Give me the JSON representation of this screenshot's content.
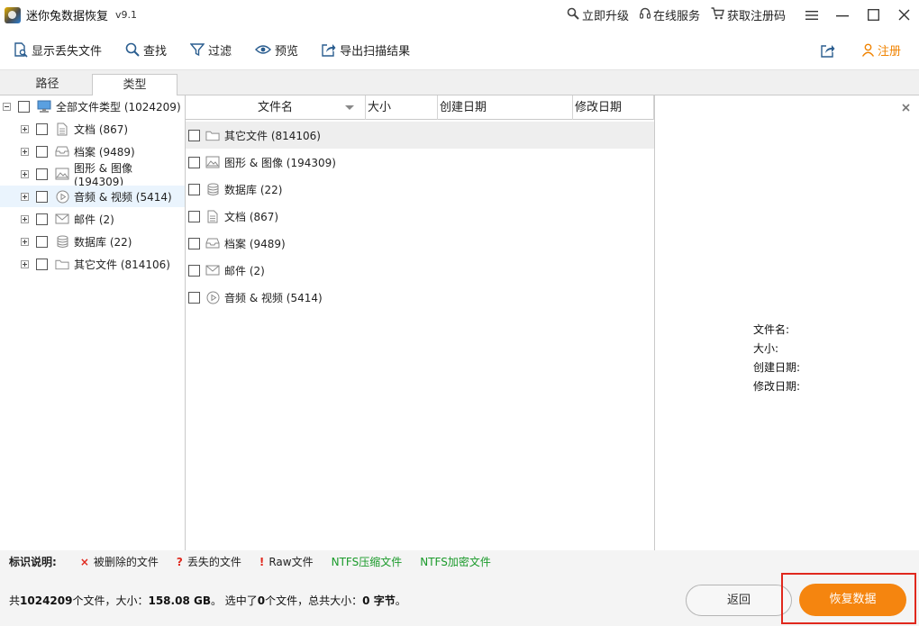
{
  "app": {
    "title": "迷你兔数据恢复",
    "version": "v9.1",
    "upgrade": "立即升级",
    "online_service": "在线服务",
    "get_code": "获取注册码"
  },
  "toolbar": {
    "show_lost": "显示丢失文件",
    "find": "查找",
    "filter": "过滤",
    "preview": "预览",
    "export": "导出扫描结果",
    "register": "注册"
  },
  "tabs": [
    "路径",
    "类型"
  ],
  "tree": {
    "root": "全部文件类型 (1024209)",
    "items": [
      {
        "label": "文档 (867)",
        "icon": "document-icon"
      },
      {
        "label": "档案 (9489)",
        "icon": "archive-icon"
      },
      {
        "label": "图形 & 图像 (194309)",
        "icon": "image-icon"
      },
      {
        "label": "音频 & 视频 (5414)",
        "icon": "media-icon"
      },
      {
        "label": "邮件 (2)",
        "icon": "mail-icon"
      },
      {
        "label": "数据库 (22)",
        "icon": "database-icon"
      },
      {
        "label": "其它文件 (814106)",
        "icon": "folder-icon"
      }
    ]
  },
  "columns": {
    "name": "文件名",
    "size": "大小",
    "created": "创建日期",
    "modified": "修改日期"
  },
  "files": [
    {
      "label": "其它文件 (814106)",
      "icon": "folder-icon"
    },
    {
      "label": "图形 & 图像 (194309)",
      "icon": "image-icon"
    },
    {
      "label": "数据库 (22)",
      "icon": "database-icon"
    },
    {
      "label": "文档 (867)",
      "icon": "document-icon"
    },
    {
      "label": "档案 (9489)",
      "icon": "archive-icon"
    },
    {
      "label": "邮件 (2)",
      "icon": "mail-icon"
    },
    {
      "label": "音频 & 视频 (5414)",
      "icon": "media-icon"
    }
  ],
  "properties": {
    "name": "文件名:",
    "size": "大小:",
    "created": "创建日期:",
    "modified": "修改日期:"
  },
  "legend": {
    "title": "标识说明:",
    "deleted_mark": "×",
    "deleted": "被删除的文件",
    "lost_mark": "?",
    "lost": "丢失的文件",
    "raw_mark": "!",
    "raw": "Raw文件",
    "ntfs_compressed": "NTFS压缩文件",
    "ntfs_encrypted": "NTFS加密文件"
  },
  "status": {
    "p1": "共",
    "total_files": "1024209",
    "p2": "个文件，大小：",
    "total_size": "158.08 GB",
    "p3": "。 选中了",
    "selected_count": "0",
    "p4": "个文件，总共大小：",
    "selected_size": "0 字节",
    "p5": "。"
  },
  "buttons": {
    "back": "返回",
    "recover": "恢复数据"
  },
  "colors": {
    "accent": "#f5850f",
    "register": "#f08300",
    "ntfs": "#1a9a2a",
    "mark_red": "#e0281d",
    "highlight_frame": "#e0281d"
  }
}
